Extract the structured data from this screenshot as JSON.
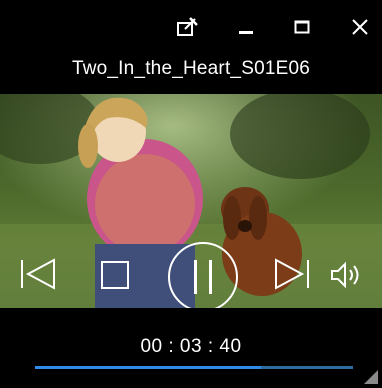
{
  "window": {
    "title": "Two_In_the_Heart_S01E06",
    "controls": {
      "pin_icon": "pin-window-icon",
      "minimize_icon": "minimize-icon",
      "maximize_icon": "maximize-icon",
      "close_icon": "close-icon"
    }
  },
  "player": {
    "icons": [
      "previous-icon",
      "stop-icon",
      "pause-icon",
      "next-icon",
      "volume-icon"
    ],
    "time": "00 : 03 : 40",
    "progress": 0.71,
    "accent_color": "#2f8ae8"
  }
}
